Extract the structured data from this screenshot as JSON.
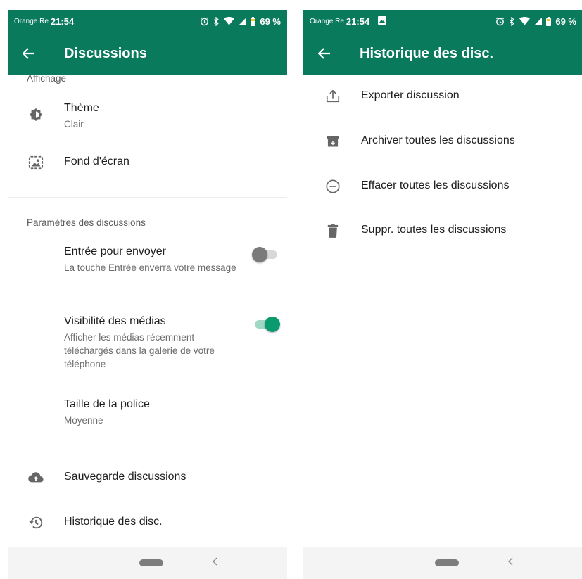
{
  "left": {
    "status": {
      "carrier": "Orange Re",
      "time": "21:54",
      "battery": "69 %"
    },
    "appbar": {
      "title": "Discussions"
    },
    "display": {
      "header": "Affichage",
      "theme": {
        "title": "Thème",
        "value": "Clair",
        "icon": "brightness-icon"
      },
      "wallpaper": {
        "title": "Fond d'écran",
        "icon": "wallpaper-icon"
      }
    },
    "chat_settings": {
      "header": "Paramètres des discussions",
      "enter_send": {
        "title": "Entrée pour envoyer",
        "subtitle": "La touche Entrée enverra votre message",
        "enabled": false
      },
      "media_visibility": {
        "title": "Visibilité des médias",
        "subtitle": "Afficher les médias récemment téléchargés dans la galerie de votre téléphone",
        "enabled": true
      },
      "font_size": {
        "title": "Taille de la police",
        "value": "Moyenne"
      }
    },
    "backup": {
      "title": "Sauvegarde discussions",
      "icon": "cloud-upload-icon"
    },
    "history": {
      "title": "Historique des disc.",
      "icon": "history-icon"
    }
  },
  "right": {
    "status": {
      "carrier": "Orange Re",
      "time": "21:54",
      "battery": "69 %"
    },
    "appbar": {
      "title": "Historique des disc."
    },
    "items": [
      {
        "label": "Exporter discussion",
        "icon": "export-icon"
      },
      {
        "label": "Archiver toutes les discussions",
        "icon": "archive-icon"
      },
      {
        "label": "Effacer toutes les discussions",
        "icon": "minus-circle-icon"
      },
      {
        "label": "Suppr. toutes les discussions",
        "icon": "trash-icon"
      }
    ]
  },
  "colors": {
    "primary": "#0a7a5c",
    "accent": "#0a9a70",
    "navbar": "#f4f4f4"
  }
}
